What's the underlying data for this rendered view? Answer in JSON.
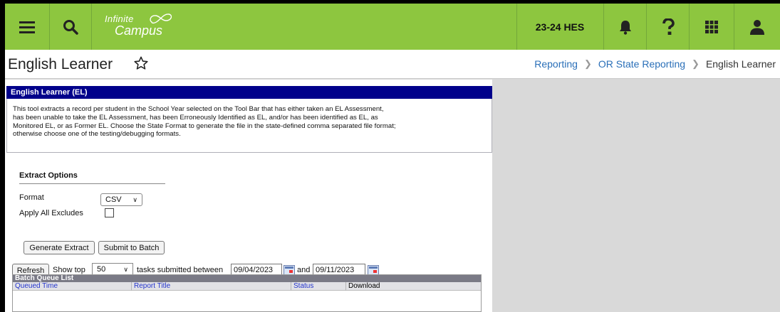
{
  "topbar": {
    "menu_icon": "hamburger-menu-icon",
    "search_icon": "search-icon",
    "logo_line1": "Infinite",
    "logo_line2": "Campus",
    "school_year": "23-24 HES",
    "notifications_icon": "bell-icon",
    "help_icon": "question-mark-icon",
    "apps_icon": "app-grid-icon",
    "user_icon": "user-icon",
    "bar_color": "#8dc63f"
  },
  "header": {
    "title": "English Learner",
    "favorite_icon": "star-outline-icon",
    "breadcrumbs": [
      "Reporting",
      "OR State Reporting",
      "English Learner"
    ]
  },
  "panel": {
    "section_title": "English Learner (EL)",
    "description_lines": [
      "This tool extracts a record per student in the School Year selected on the Tool Bar that has either taken an EL Assessment,",
      "has been unable to take the EL Assessment, has been Erroneously Identified as EL, and/or has been identified as EL, as",
      "Monitored EL, or as Former EL. Choose the State Format to generate the file in the state-defined comma separated file format;",
      "otherwise choose one of the testing/debugging formats."
    ],
    "extract_options_title": "Extract Options",
    "format_label": "Format",
    "format_value": "CSV",
    "apply_excludes_label": "Apply All Excludes",
    "apply_excludes_checked": false,
    "generate_extract_label": "Generate Extract",
    "submit_batch_label": "Submit to Batch"
  },
  "batch": {
    "refresh_label": "Refresh",
    "show_top_label": "Show top",
    "show_top_value": "50",
    "tasks_label": "tasks submitted between",
    "start_date": "09/04/2023",
    "and_label": "and",
    "end_date": "09/11/2023",
    "list_title": "Batch Queue List",
    "columns": [
      "Queued Time",
      "Report Title",
      "Status",
      "Download"
    ]
  }
}
